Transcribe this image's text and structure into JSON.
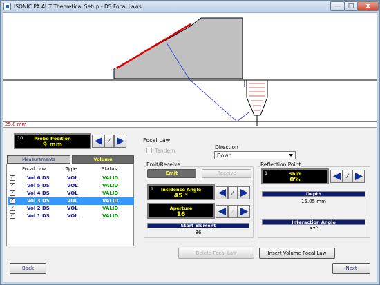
{
  "window": {
    "title": "ISONIC PA AUT Theoretical Setup - DS Focal Laws",
    "minimize": "—",
    "maximize": "□",
    "close": "x"
  },
  "canvas": {
    "distance_label": "25.8 mm"
  },
  "probe_position": {
    "index": "10",
    "label": "Probe Position",
    "value": "9 mm"
  },
  "tabs": [
    {
      "label": "Measurements"
    },
    {
      "label": "Volume"
    }
  ],
  "table": {
    "headers": [
      "Focal Law",
      "Type",
      "Status"
    ],
    "rows": [
      {
        "checked": "✓",
        "focal_law": "Vol 6 DS",
        "type": "VOL",
        "status": "VALID"
      },
      {
        "checked": "✓",
        "focal_law": "Vol 5 DS",
        "type": "VOL",
        "status": "VALID"
      },
      {
        "checked": "✓",
        "focal_law": "Vol 4 DS",
        "type": "VOL",
        "status": "VALID"
      },
      {
        "checked": "✓",
        "focal_law": "Vol 3 DS",
        "type": "VOL",
        "status": "VALID"
      },
      {
        "checked": "✓",
        "focal_law": "Vol 2 DS",
        "type": "VOL",
        "status": "VALID"
      },
      {
        "checked": "✓",
        "focal_law": "Vol 1 DS",
        "type": "VOL",
        "status": "VALID"
      }
    ],
    "selected_row": 3
  },
  "focal_law": {
    "heading": "Focal Law",
    "tandem_label": "Tandem",
    "direction_label": "Direction",
    "direction_value": "Down"
  },
  "emit_receive": {
    "heading": "Emit/Receive",
    "emit_label": "Emit",
    "receive_label": "Receive",
    "incidence_index": "1",
    "incidence_label": "Incidence Angle",
    "incidence_value": "45 °",
    "aperture_label": "Aperture",
    "aperture_value": "16",
    "start_element_label": "Start Element",
    "start_element_value": "36"
  },
  "reflection_point": {
    "heading": "Reflection Point",
    "shift_index": "1",
    "shift_label": "Shift",
    "shift_value": "0%",
    "depth_label": "Depth",
    "depth_value": "15.05 mm",
    "interaction_label": "Interaction Angle",
    "interaction_value": "37°"
  },
  "buttons": {
    "delete_focal_law": "Delete Focal Law",
    "insert_volume_focal_law": "Insert Volume Focal Law",
    "back": "Back",
    "next": "Next"
  },
  "colors": {
    "accent_blue": "#0e2f9e",
    "valid_green": "#00a000",
    "selection": "#3399ff",
    "wedge_highlight": "#e00000"
  }
}
